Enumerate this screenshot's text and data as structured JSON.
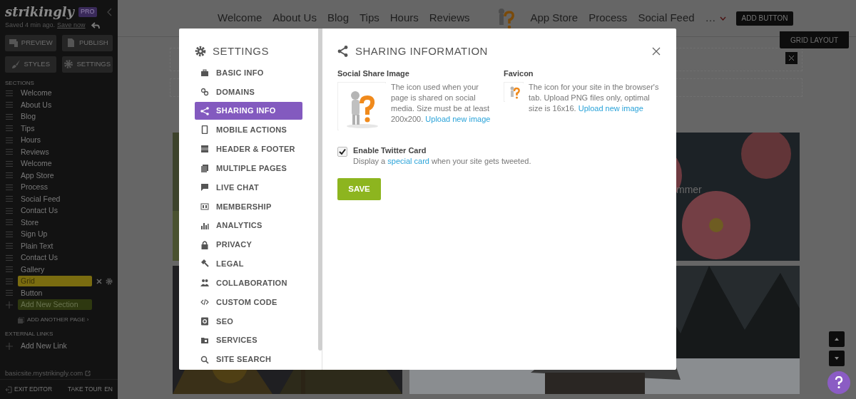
{
  "editor_sidebar": {
    "logo": "strikingly",
    "badge": "PRO",
    "saved_text": "Saved 4 min ago.",
    "save_link": "Save now",
    "buttons": [
      {
        "label": "PREVIEW"
      },
      {
        "label": "PUBLISH"
      },
      {
        "label": "STYLES"
      },
      {
        "label": "SETTINGS"
      }
    ],
    "sections_heading": "SECTIONS",
    "sections": [
      {
        "label": "Welcome",
        "selected": false
      },
      {
        "label": "About Us",
        "selected": false
      },
      {
        "label": "Blog",
        "selected": false
      },
      {
        "label": "Tips",
        "selected": false
      },
      {
        "label": "Hours",
        "selected": false
      },
      {
        "label": "Reviews",
        "selected": false
      },
      {
        "label": "Welcome",
        "selected": false
      },
      {
        "label": "App Store",
        "selected": false
      },
      {
        "label": "Process",
        "selected": false
      },
      {
        "label": "Social Feed",
        "selected": false
      },
      {
        "label": "Contact Us",
        "selected": false
      },
      {
        "label": "Store",
        "selected": false
      },
      {
        "label": "Sign Up",
        "selected": false
      },
      {
        "label": "Plain Text",
        "selected": false
      },
      {
        "label": "Contact Us",
        "selected": false
      },
      {
        "label": "Gallery",
        "selected": false
      },
      {
        "label": "Grid",
        "selected": true
      },
      {
        "label": "Button",
        "selected": false
      }
    ],
    "add_section": "Add New Section",
    "add_page": "ADD ANOTHER PAGE ›",
    "external_heading": "EXTERNAL LINKS",
    "add_link": "Add New Link",
    "site_url": "basicsite.mystrikingly.com",
    "footer": [
      "EXIT EDITOR",
      "TAKE TOUR",
      "EN"
    ]
  },
  "site_nav": {
    "left": [
      "Welcome",
      "About Us",
      "Blog",
      "Tips",
      "Hours",
      "Reviews"
    ],
    "right": [
      "App Store",
      "Process",
      "Social Feed"
    ],
    "more": "…",
    "add_button": "ADD BUTTON"
  },
  "grid_layout_button": "GRID LAYOUT",
  "section_caption": "mmer",
  "settings_modal": {
    "title": "SETTINGS",
    "menu": [
      {
        "label": "BASIC INFO",
        "selected": false
      },
      {
        "label": "DOMAINS",
        "selected": false
      },
      {
        "label": "SHARING INFO",
        "selected": true
      },
      {
        "label": "MOBILE ACTIONS",
        "selected": false
      },
      {
        "label": "HEADER & FOOTER",
        "selected": false
      },
      {
        "label": "MULTIPLE PAGES",
        "selected": false
      },
      {
        "label": "LIVE CHAT",
        "selected": false
      },
      {
        "label": "MEMBERSHIP",
        "selected": false
      },
      {
        "label": "ANALYTICS",
        "selected": false
      },
      {
        "label": "PRIVACY",
        "selected": false
      },
      {
        "label": "LEGAL",
        "selected": false
      },
      {
        "label": "COLLABORATION",
        "selected": false
      },
      {
        "label": "CUSTOM CODE",
        "selected": false
      },
      {
        "label": "SEO",
        "selected": false
      },
      {
        "label": "SERVICES",
        "selected": false
      },
      {
        "label": "SITE SEARCH",
        "selected": false
      }
    ],
    "heading": "SHARING INFORMATION",
    "images": [
      {
        "title": "Social Share Image",
        "description": "The icon used when your page is shared on social media. Size must be at least 200x200.",
        "link": "Upload new image"
      },
      {
        "title": "Favicon",
        "description": "The icon for your site in the browser's tab. Upload PNG files only, optimal size is 16x16.",
        "link": "Upload new image"
      }
    ],
    "twitter": {
      "label": "Enable Twitter Card",
      "checked": true,
      "text_before": "Display a",
      "link": "special card",
      "text_after": "when your site gets tweeted."
    },
    "save": "SAVE"
  }
}
